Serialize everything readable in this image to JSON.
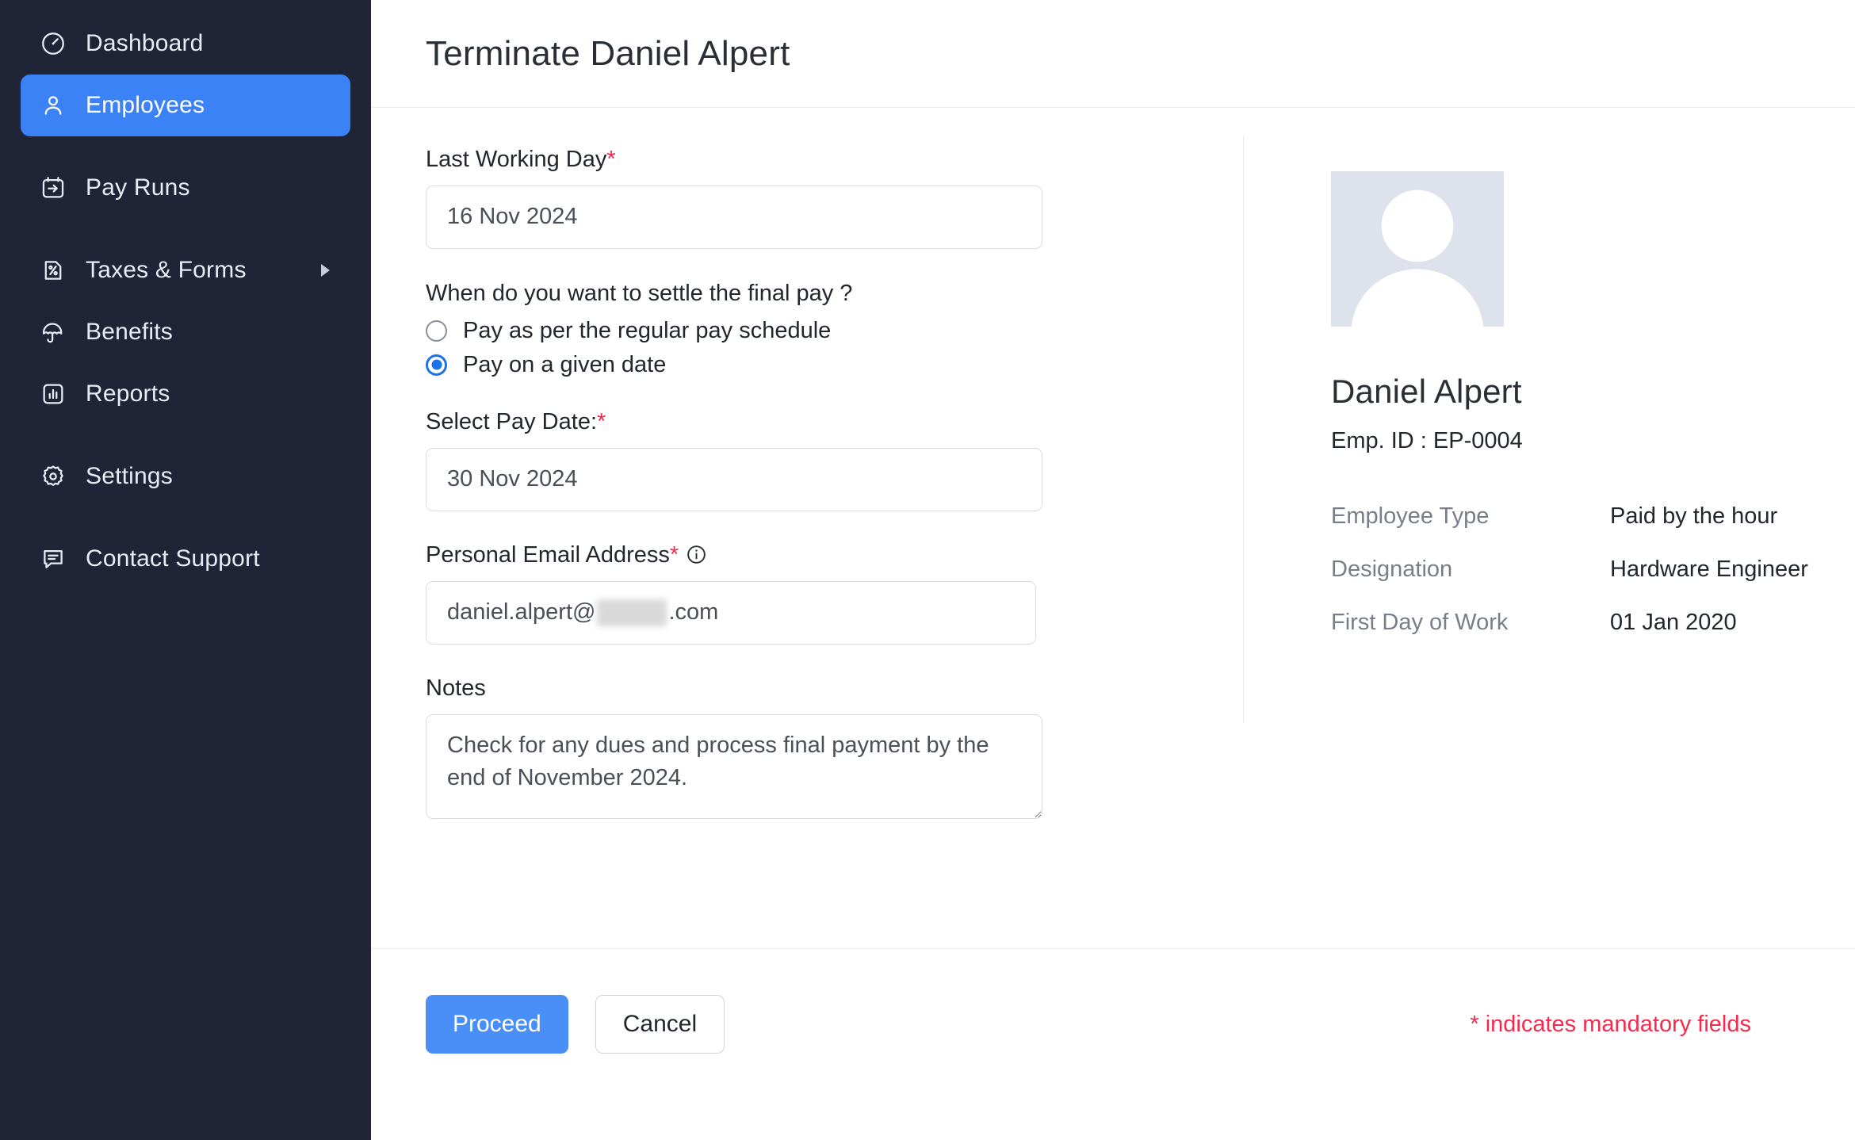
{
  "sidebar": {
    "items": [
      {
        "label": "Dashboard",
        "icon": "speedometer-icon",
        "active": false,
        "has_submenu": false
      },
      {
        "label": "Employees",
        "icon": "user-icon",
        "active": true,
        "has_submenu": false
      },
      {
        "label": "Pay Runs",
        "icon": "calendar-arrow-icon",
        "active": false,
        "has_submenu": false
      },
      {
        "label": "Taxes & Forms",
        "icon": "percent-document-icon",
        "active": false,
        "has_submenu": true
      },
      {
        "label": "Benefits",
        "icon": "umbrella-icon",
        "active": false,
        "has_submenu": false
      },
      {
        "label": "Reports",
        "icon": "bar-chart-icon",
        "active": false,
        "has_submenu": false
      },
      {
        "label": "Settings",
        "icon": "gear-icon",
        "active": false,
        "has_submenu": false
      },
      {
        "label": "Contact Support",
        "icon": "chat-icon",
        "active": false,
        "has_submenu": false
      }
    ]
  },
  "header": {
    "title": "Terminate Daniel Alpert"
  },
  "form": {
    "last_working_day": {
      "label": "Last Working Day",
      "required_marker": "*",
      "value": "16 Nov 2024"
    },
    "settle_question": "When do you want to settle the final pay ?",
    "settle_options": [
      {
        "label": "Pay as per the regular pay schedule",
        "selected": false
      },
      {
        "label": "Pay on a given date",
        "selected": true
      }
    ],
    "pay_date": {
      "label": "Select Pay Date:",
      "required_marker": "*",
      "value": "30 Nov 2024"
    },
    "personal_email": {
      "label": "Personal Email Address",
      "required_marker": "*",
      "info_icon": "info-icon",
      "value_prefix": "daniel.alpert@",
      "value_suffix": ".com",
      "value_redacted": true
    },
    "notes": {
      "label": "Notes",
      "value": "Check for any dues and process final payment by the end of November 2024."
    }
  },
  "profile": {
    "avatar_icon": "user-placeholder-avatar",
    "name": "Daniel Alpert",
    "emp_id_line": "Emp. ID : EP-0004",
    "details": [
      {
        "key": "Employee Type",
        "value": "Paid by the hour"
      },
      {
        "key": "Designation",
        "value": "Hardware Engineer"
      },
      {
        "key": "First Day of Work",
        "value": "01 Jan 2020"
      }
    ]
  },
  "footer": {
    "proceed_label": "Proceed",
    "cancel_label": "Cancel",
    "mandatory_note": "* indicates mandatory fields"
  },
  "colors": {
    "sidebar_bg": "#1f2537",
    "accent_blue": "#3b82f6",
    "primary_button": "#4a8ff7",
    "required_red": "#f5294c",
    "radio_selected": "#1a73e8"
  }
}
